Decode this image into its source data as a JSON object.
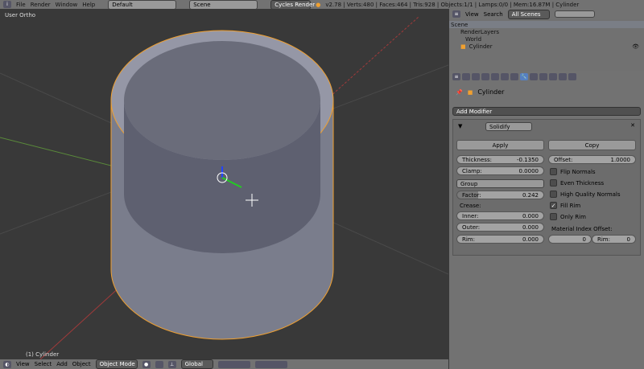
{
  "topbar": {
    "menus": [
      "File",
      "Render",
      "Window",
      "Help"
    ],
    "screen": "Default",
    "scene": "Scene",
    "engine": "Cycles Render",
    "info": "v2.78 | Verts:480 | Faces:464 | Tris:928 | Objects:1/1 | Lamps:0/0 | Mem:16.87M | Cylinder"
  },
  "viewport": {
    "label": "User Ortho",
    "object_label": "(1) Cylinder"
  },
  "outliner": {
    "menus": [
      "View",
      "Search"
    ],
    "filter": "All Scenes",
    "items": [
      "Scene",
      "RenderLayers",
      "World",
      "Cylinder"
    ]
  },
  "props": {
    "object": "Cylinder",
    "add_modifier": "Add Modifier",
    "modifier": {
      "name": "Solidify",
      "apply": "Apply",
      "copy": "Copy",
      "thickness_label": "Thickness:",
      "thickness": "-0.1350",
      "offset_label": "Offset:",
      "offset": "1.0000",
      "clamp_label": "Clamp:",
      "clamp": "0.0000",
      "group": "Group",
      "factor_label": "Factor:",
      "factor": "0.242",
      "factor_fraction": 0.242,
      "crease_label": "Crease:",
      "inner_label": "Inner:",
      "inner": "0.000",
      "outer_label": "Outer:",
      "outer": "0.000",
      "rim_label": "Rim:",
      "rim": "0.000",
      "flip_normals": "Flip Normals",
      "even_thickness": "Even Thickness",
      "hq_normals": "High Quality Normals",
      "fill_rim": "Fill Rim",
      "only_rim": "Only Rim",
      "mat_offset_label": "Material Index Offset:",
      "mat_offset": "0",
      "mat_rim_label": "Rim:",
      "mat_rim": "0",
      "checks": {
        "flip_normals": false,
        "even_thickness": false,
        "hq_normals": false,
        "fill_rim": true,
        "only_rim": false
      }
    }
  },
  "bottombar": {
    "menus": [
      "View",
      "Select",
      "Add",
      "Object"
    ],
    "mode": "Object Mode",
    "orientation": "Global"
  },
  "colors": {
    "selection": "#f0a030",
    "panel": "#727272",
    "viewport": "#393939"
  }
}
